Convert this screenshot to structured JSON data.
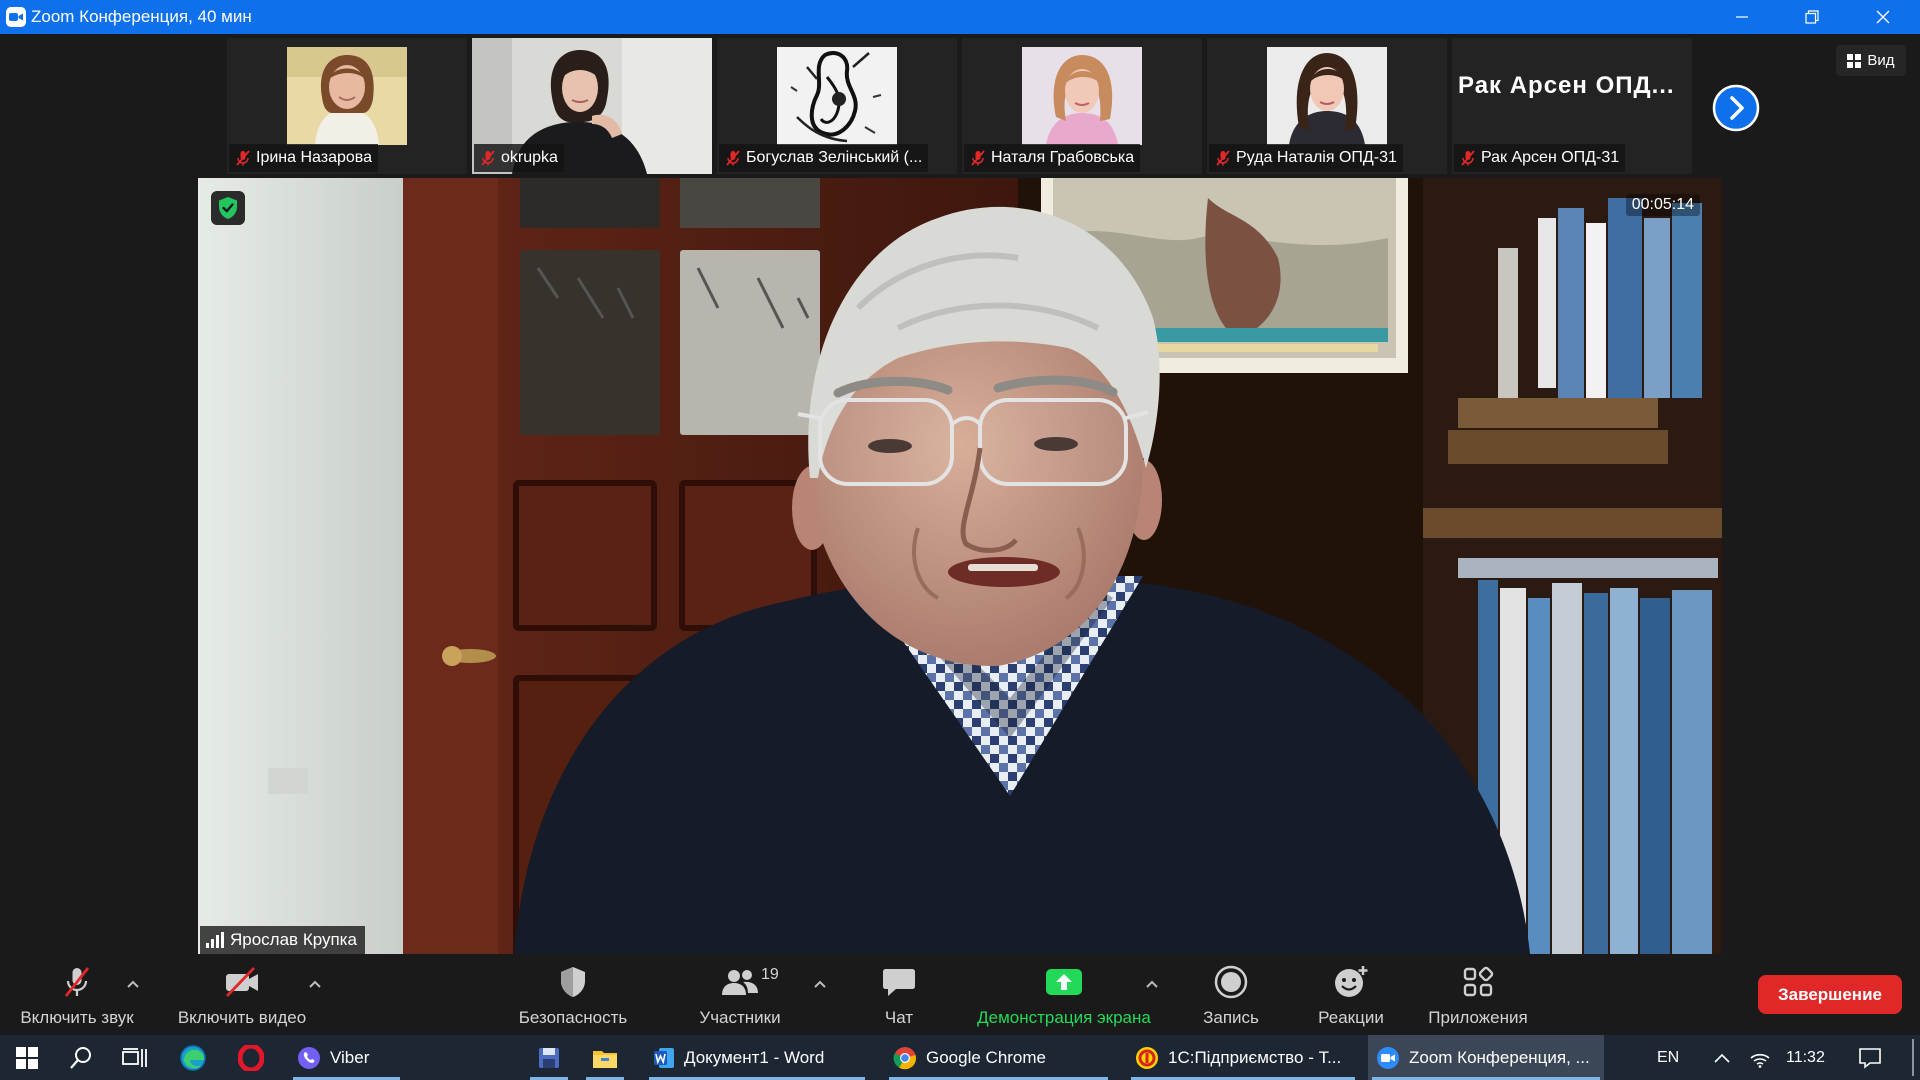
{
  "window": {
    "title": "Zoom Конференция, 40 мин",
    "app_icon": "zoom-camera-icon",
    "controls": [
      "minimize-icon",
      "restore-icon",
      "close-icon"
    ],
    "titlebar_color": "#0E71EB"
  },
  "view_button": {
    "label": "Вид",
    "icon": "grid-icon"
  },
  "gallery": {
    "next_icon": "chevron-right-circle-icon",
    "participants": [
      {
        "name": "Ірина Назарова",
        "muted": true,
        "video_on": true
      },
      {
        "name": "okrupka",
        "muted": true,
        "video_on": true
      },
      {
        "name": "Богуслав Зелінський (...",
        "muted": true,
        "video_on": true
      },
      {
        "name": "Наталя Грабовська",
        "muted": true,
        "video_on": true
      },
      {
        "name": "Руда Наталія ОПД-31",
        "muted": true,
        "video_on": true
      },
      {
        "name": "Рак Арсен ОПД-31",
        "muted": true,
        "video_on": false,
        "display_name": "Рак Арсен ОПД..."
      }
    ]
  },
  "main_video": {
    "speaker": "Ярослав Крупка",
    "timer": "00:05:14",
    "encryption_icon": "shield-check-icon",
    "signal_icon": "signal-bars-icon"
  },
  "toolbar": {
    "audio": {
      "label": "Включить звук",
      "icon": "microphone-muted-icon"
    },
    "video": {
      "label": "Включить видео",
      "icon": "camera-off-icon"
    },
    "security": {
      "label": "Безопасность",
      "icon": "shield-icon"
    },
    "participants": {
      "label": "Участники",
      "count": "19",
      "icon": "people-icon"
    },
    "chat": {
      "label": "Чат",
      "icon": "chat-bubble-icon"
    },
    "share": {
      "label": "Демонстрация экрана",
      "icon": "share-screen-icon",
      "color": "#23D959"
    },
    "record": {
      "label": "Запись",
      "icon": "record-icon"
    },
    "reactions": {
      "label": "Реакции",
      "icon": "smiley-plus-icon"
    },
    "apps": {
      "label": "Приложения",
      "icon": "apps-icon"
    },
    "end": {
      "label": "Завершение",
      "color": "#E02828"
    }
  },
  "taskbar": {
    "pinned_icons": [
      "windows-logo-icon",
      "search-icon",
      "task-view-icon",
      "edge-icon",
      "opera-icon",
      "save-icon",
      "file-explorer-icon"
    ],
    "apps": {
      "viber": "Viber",
      "word": "Документ1 - Word",
      "chrome": "Google Chrome",
      "onec": "1С:Підприємство - Т...",
      "zoom": "Zoom Конференция, ..."
    },
    "active_app": "zoom",
    "language": "EN",
    "time": "11:32"
  }
}
